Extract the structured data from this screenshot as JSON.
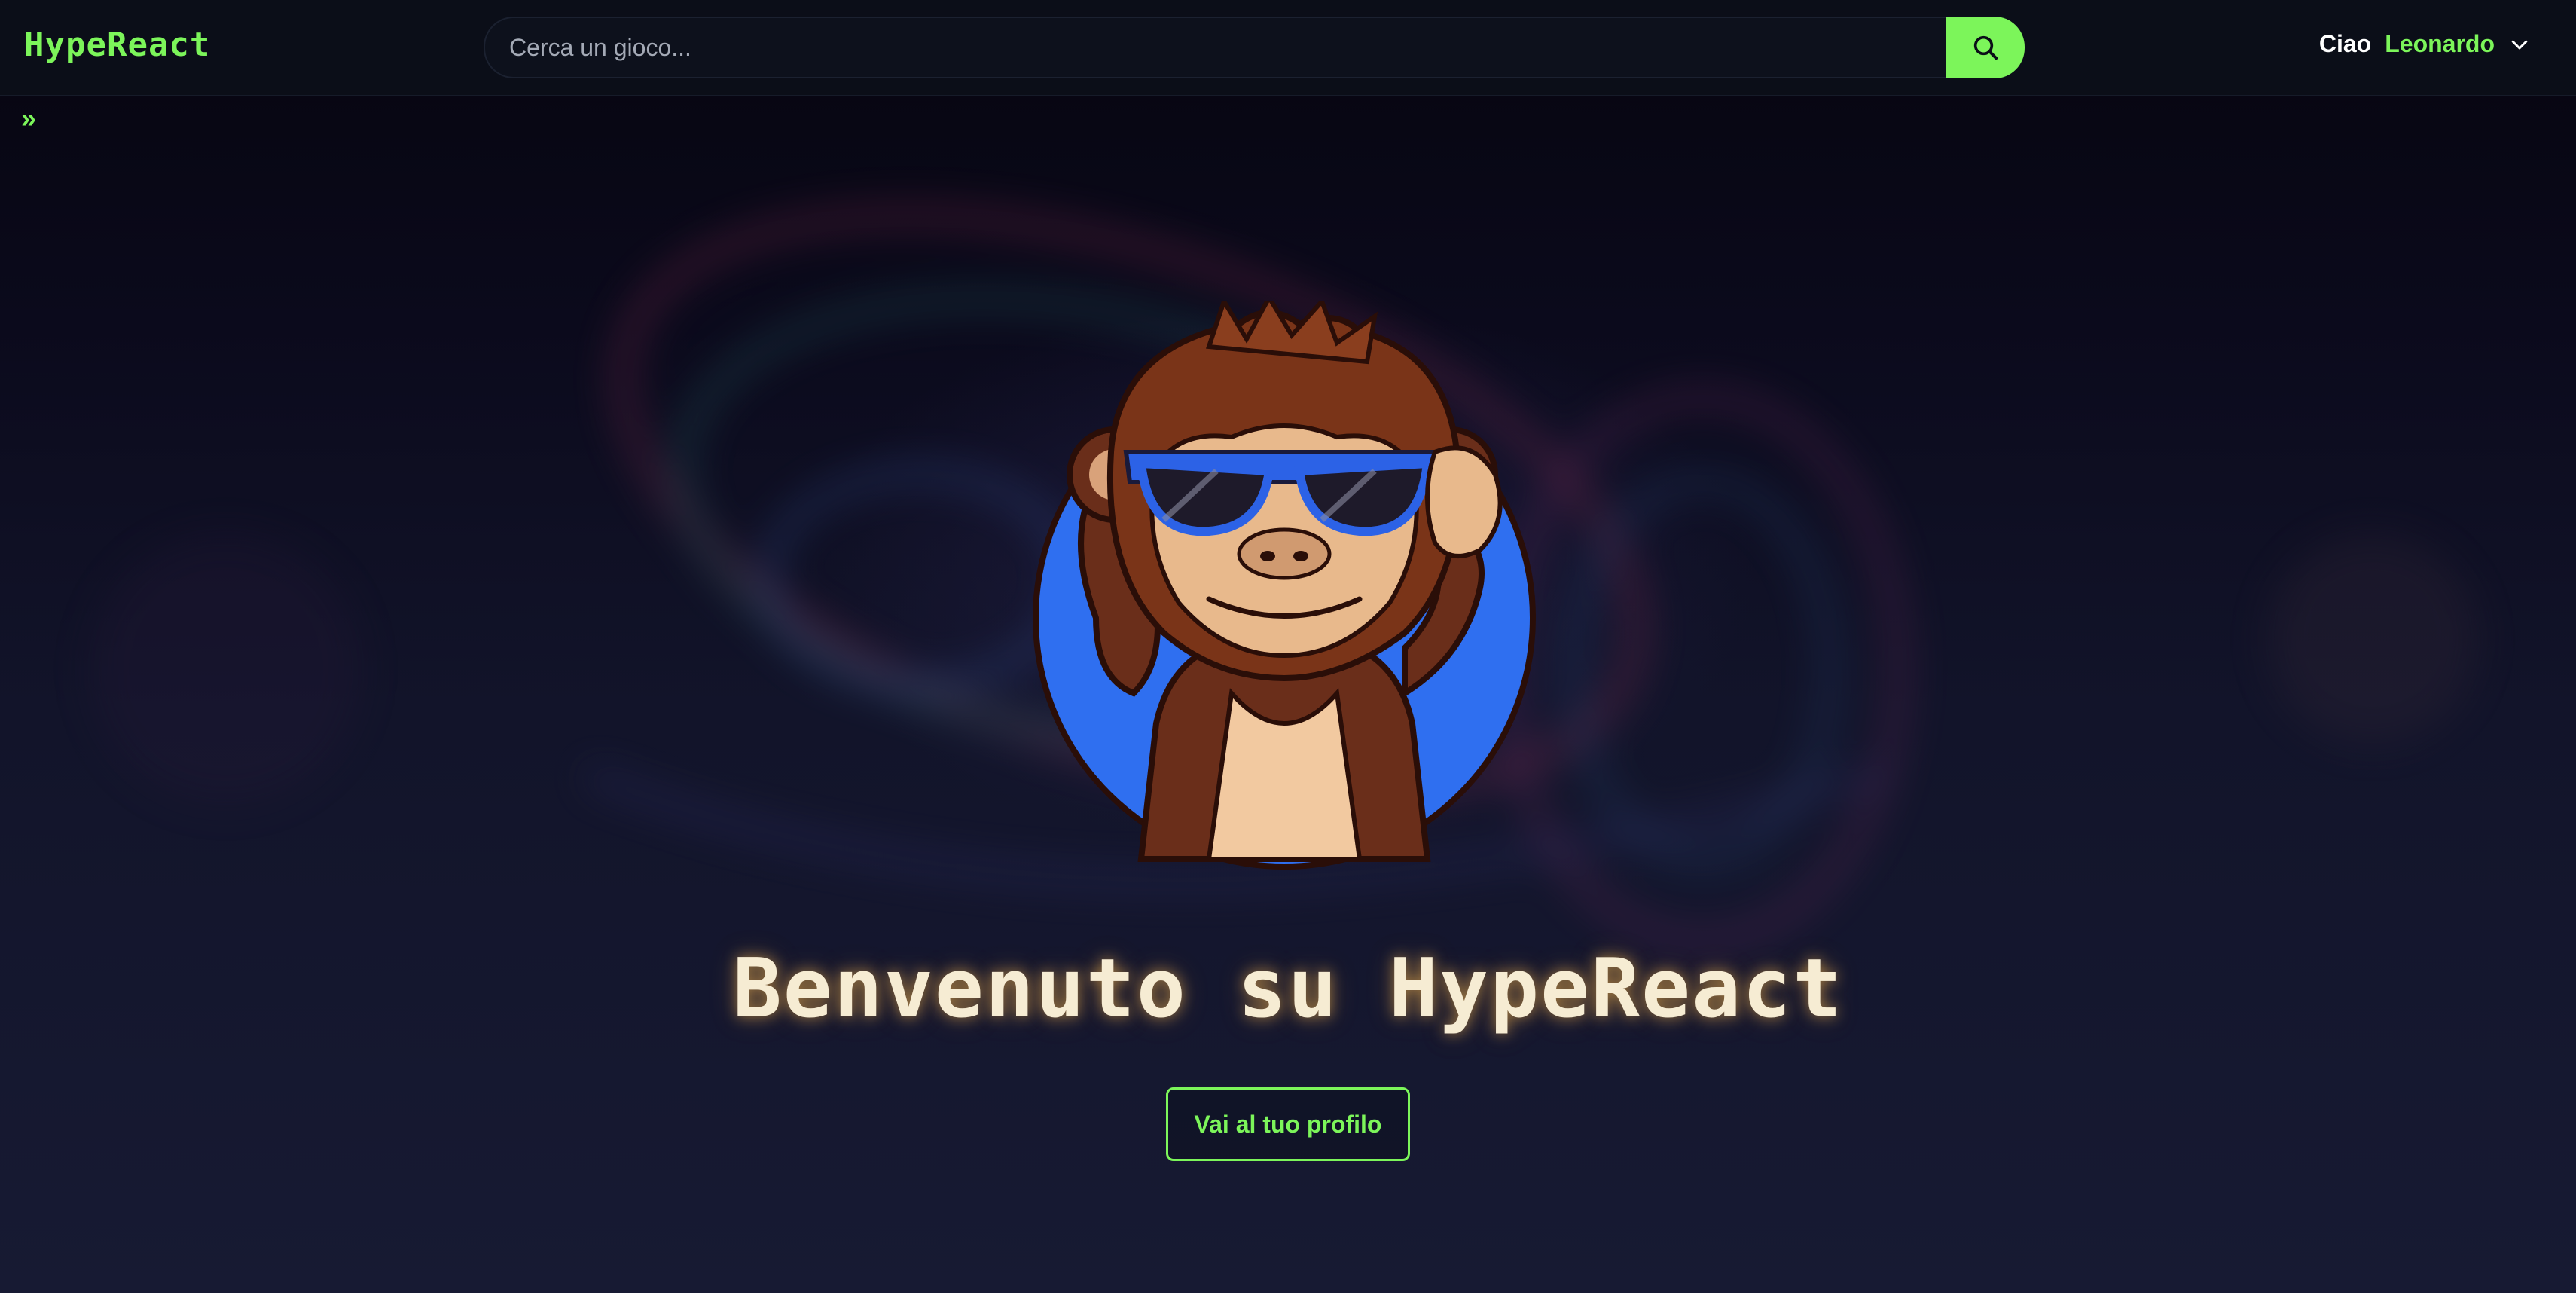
{
  "navbar": {
    "brand": "HypeReact",
    "search": {
      "placeholder": "Cerca un gioco...",
      "value": "",
      "button_icon": "search-icon"
    },
    "user": {
      "greeting": "Ciao",
      "name": "Leonardo",
      "menu_icon": "chevron-down-icon"
    }
  },
  "sidebar_toggle": {
    "label": "»",
    "icon": "double-chevron-right-icon"
  },
  "hero": {
    "logo": "monkey-with-sunglasses-logo",
    "title": "Benvenuto su HypeReact",
    "cta_label": "Vai al tuo profilo"
  },
  "colors": {
    "accent": "#7cf55a",
    "navbar_bg": "#0b0e18",
    "title_glow": "#f6ecd3",
    "logo_circle": "#2f6ff0"
  }
}
